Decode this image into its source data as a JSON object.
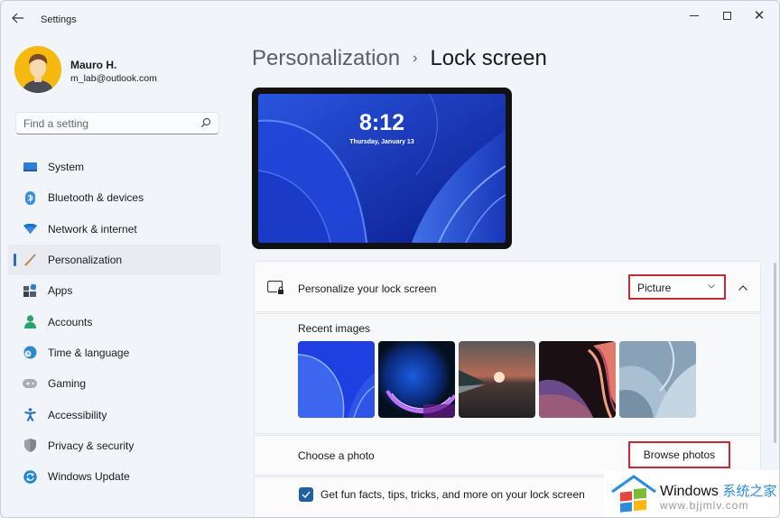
{
  "window": {
    "title": "Settings",
    "controls": {
      "minimize": "minimize",
      "maximize": "maximize",
      "close": "close"
    }
  },
  "profile": {
    "name": "Mauro H.",
    "email": "m_lab@outlook.com"
  },
  "search": {
    "placeholder": "Find a setting",
    "value": ""
  },
  "sidebar": {
    "items": [
      {
        "label": "System",
        "icon": "monitor-icon",
        "active": false
      },
      {
        "label": "Bluetooth & devices",
        "icon": "bluetooth-icon",
        "active": false
      },
      {
        "label": "Network & internet",
        "icon": "wifi-icon",
        "active": false
      },
      {
        "label": "Personalization",
        "icon": "paintbrush-icon",
        "active": true
      },
      {
        "label": "Apps",
        "icon": "apps-icon",
        "active": false
      },
      {
        "label": "Accounts",
        "icon": "person-icon",
        "active": false
      },
      {
        "label": "Time & language",
        "icon": "globe-clock-icon",
        "active": false
      },
      {
        "label": "Gaming",
        "icon": "gamepad-icon",
        "active": false
      },
      {
        "label": "Accessibility",
        "icon": "accessibility-icon",
        "active": false
      },
      {
        "label": "Privacy & security",
        "icon": "shield-icon",
        "active": false
      },
      {
        "label": "Windows Update",
        "icon": "update-icon",
        "active": false
      }
    ]
  },
  "header": {
    "parent": "Personalization",
    "separator": "›",
    "current": "Lock screen"
  },
  "preview": {
    "time": "8:12",
    "date": "Thursday, January 13"
  },
  "personalize": {
    "label": "Personalize your lock screen",
    "dropdown_value": "Picture",
    "recent_label": "Recent images",
    "recent_images": [
      "blue-bloom-wallpaper",
      "dark-orb-wallpaper",
      "sunset-lake-wallpaper",
      "purple-flow-wallpaper",
      "grey-bloom-wallpaper"
    ],
    "choose_label": "Choose a photo",
    "browse_label": "Browse photos",
    "checkbox_label": "Get fun facts, tips, tricks, and more on your lock screen",
    "checkbox_checked": true
  },
  "watermark": {
    "title": "Windows",
    "title_cn": "系统之家",
    "url": "www.bjjmlv.com"
  },
  "colors": {
    "accent": "#2a6db5",
    "highlight_border": "#c52a35",
    "checkbox": "#1f5fa6"
  }
}
